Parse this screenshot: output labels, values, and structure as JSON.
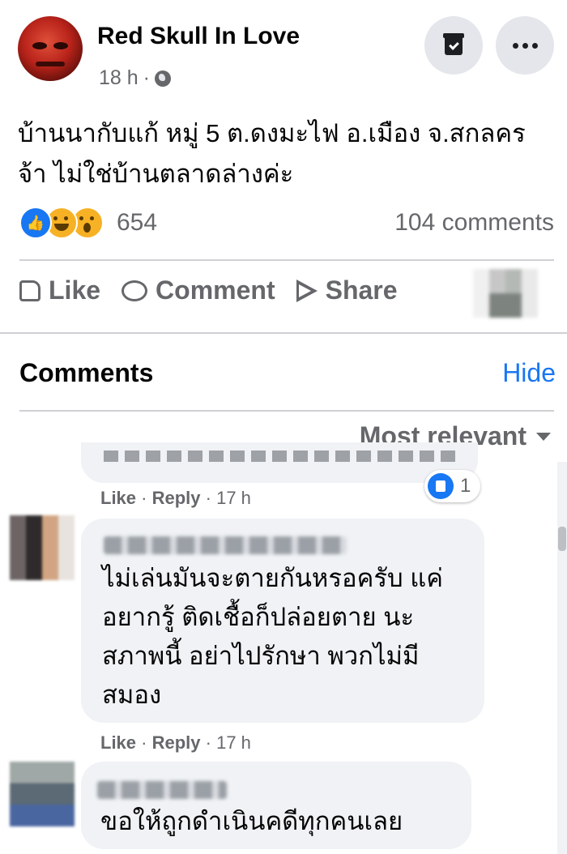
{
  "post": {
    "author": "Red Skull In Love",
    "time": "18 h",
    "separator": "·",
    "text": "บ้านนากับแก้ หมู่ 5 ต.ดงมะไฟ อ.เมือง จ.สกลคร จ้า ไม่ใช่บ้านตลาดล่างค่ะ",
    "reaction_count": "654",
    "comment_count": "104 comments"
  },
  "actions": {
    "like": "Like",
    "comment": "Comment",
    "share": "Share"
  },
  "comments_section": {
    "title": "Comments",
    "hide": "Hide",
    "sort": "Most relevant"
  },
  "comments": [
    {
      "like": "Like",
      "reply": "Reply",
      "time": "17 h",
      "reaction_count": "1"
    },
    {
      "text": "ไม่เล่นมันจะตายกันหรอครับ แค่อยากรู้ ติดเชื้อก็ปล่อยตาย นะสภาพนี้ อย่าไปรักษา พวกไม่มีสมอง",
      "like": "Like",
      "reply": "Reply",
      "time": "17 h"
    },
    {
      "text": "ขอให้ถูกดำเนินคดีทุกคนเลย"
    }
  ],
  "icons": {
    "privacy": "globe-icon",
    "save": "save-icon",
    "more": "more-icon",
    "like_reaction": "like-reaction-icon",
    "haha_reaction": "haha-reaction-icon",
    "wow_reaction": "wow-reaction-icon"
  },
  "colors": {
    "accent": "#1877f2",
    "secondary_text": "#65676b",
    "bubble": "#f0f2f5"
  }
}
